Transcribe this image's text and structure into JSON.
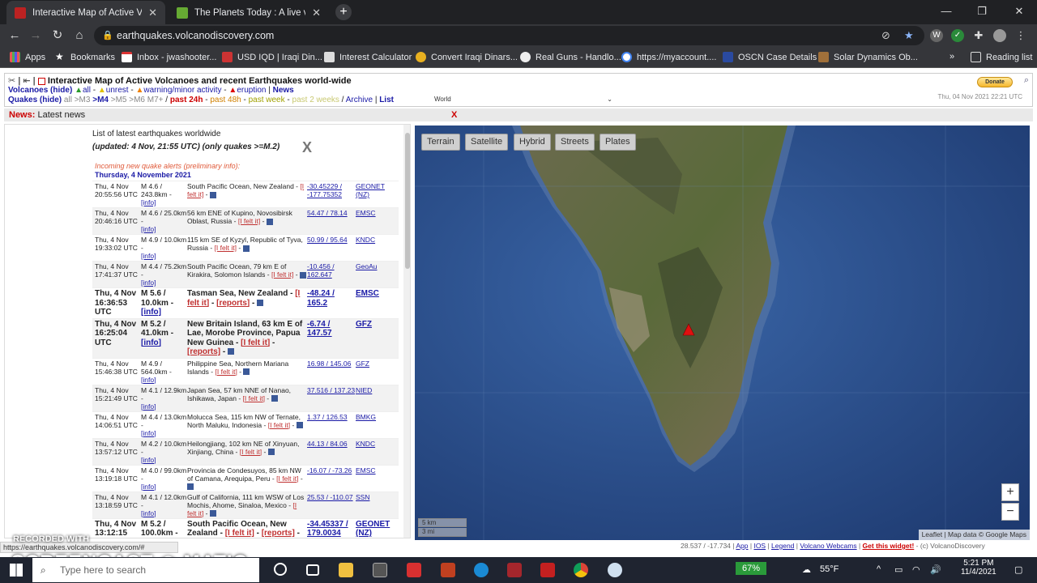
{
  "browser": {
    "tabs": [
      {
        "title": "Interactive Map of Active Volcan",
        "active": true
      },
      {
        "title": "The Planets Today : A live view of",
        "active": false
      }
    ],
    "url": "earthquakes.volcanodiscovery.com",
    "bookmarks": [
      "Apps",
      "Bookmarks",
      "Inbox - jwashooter...",
      "USD IQD | Iraqi Din...",
      "Interest Calculator",
      "Convert Iraqi Dinars...",
      "Real Guns - Handlo...",
      "https://myaccount....",
      "OSCN Case Details",
      "Solar Dynamics Ob..."
    ],
    "reading_list": "Reading list",
    "more": "»"
  },
  "header": {
    "title": "Interactive Map of Active Volcanoes and recent Earthquakes world-wide",
    "volcanoes_label": "Volcanoes (hide)",
    "v_all": "all",
    "v_unrest": "unrest",
    "v_warning": "warning/minor activity",
    "v_eruption": "eruption",
    "news_link": "News",
    "quakes_label": "Quakes (hide)",
    "q_all": "all",
    "q_m3": ">M3",
    "q_m4": ">M4",
    "q_m5": ">M5",
    "q_m6": ">M6",
    "q_m7": "M7+",
    "q_24h": "past 24h",
    "q_48h": "past 48h",
    "q_week": "past week",
    "q_2weeks": "past 2 weeks",
    "archive": "Archive",
    "list": "List",
    "region": "World",
    "donate": "Donate",
    "datetime": "Thu, 04 Nov 2021 22:21 UTC"
  },
  "newsbar": {
    "label": "News:",
    "text": "Latest news",
    "close": "X"
  },
  "list": {
    "title": "List of latest earthquakes worldwide",
    "updated": "(updated: 4 Nov, 21:55 UTC) (only quakes >=M.2)",
    "close": "X",
    "incoming": "Incoming new quake alerts (preliminary info):",
    "day": "Thursday, 4 November 2021",
    "rows": [
      {
        "time": "Thu, 4 Nov 20:55:56 UTC",
        "mag": "M 4.6 / 243.8km -",
        "info": "[info]",
        "loc": "South Pacific Ocean, New Zealand -",
        "felt": "[I felt it]",
        "reports": "",
        "coords": "-30.45229 / -177.75352",
        "agency": "GEONET (NZ)",
        "big": false
      },
      {
        "time": "Thu, 4 Nov 20:46:16 UTC",
        "mag": "M 4.6 / 25.0km -",
        "info": "[info]",
        "loc": "56 km ENE of Kupino, Novosibirsk Oblast, Russia -",
        "felt": "[I felt it]",
        "reports": "",
        "coords": "54.47 / 78.14",
        "agency": "EMSC",
        "big": false
      },
      {
        "time": "Thu, 4 Nov 19:33:02 UTC",
        "mag": "M 4.9 / 10.0km -",
        "info": "[info]",
        "loc": "115 km SE of Kyzyl, Republic of Tyva, Russia -",
        "felt": "[I felt it]",
        "reports": "",
        "coords": "50.99 / 95.64",
        "agency": "KNDC",
        "big": false
      },
      {
        "time": "Thu, 4 Nov 17:41:37 UTC",
        "mag": "M 4.4 / 75.2km -",
        "info": "[info]",
        "loc": "South Pacific Ocean, 79 km E of Kirakira, Solomon Islands -",
        "felt": "[I felt it]",
        "reports": "",
        "coords": "-10.456 / 162.647",
        "agency": "GeoAu",
        "big": false
      },
      {
        "time": "Thu, 4 Nov 16:36:53 UTC",
        "mag": "M 5.6 / 10.0km -",
        "info": "[info]",
        "loc": "Tasman Sea, New Zealand -",
        "felt": "[I felt it]",
        "reports": "[reports]",
        "coords": "-48.24 / 165.2",
        "agency": "EMSC",
        "big": true
      },
      {
        "time": "Thu, 4 Nov 16:25:04 UTC",
        "mag": "M 5.2 / 41.0km -",
        "info": "[info]",
        "loc": "New Britain Island, 63 km E of Lae, Morobe Province, Papua New Guinea -",
        "felt": "[I felt it]",
        "reports": "[reports]",
        "coords": "-6.74 / 147.57",
        "agency": "GFZ",
        "big": true
      },
      {
        "time": "Thu, 4 Nov 15:46:38 UTC",
        "mag": "M 4.9 / 564.0km -",
        "info": "[info]",
        "loc": "Philippine Sea, Northern Mariana Islands -",
        "felt": "[I felt it]",
        "reports": "",
        "coords": "16.98 / 145.06",
        "agency": "GFZ",
        "big": false
      },
      {
        "time": "Thu, 4 Nov 15:21:49 UTC",
        "mag": "M 4.1 / 12.9km -",
        "info": "[info]",
        "loc": "Japan Sea, 57 km NNE of Nanao, Ishikawa, Japan -",
        "felt": "[I felt it]",
        "reports": "",
        "coords": "37.516 / 137.23",
        "agency": "NIED",
        "big": false
      },
      {
        "time": "Thu, 4 Nov 14:06:51 UTC",
        "mag": "M 4.4 / 13.0km -",
        "info": "[info]",
        "loc": "Molucca Sea, 115 km NW of Ternate, North Maluku, Indonesia -",
        "felt": "[I felt it]",
        "reports": "",
        "coords": "1.37 / 126.53",
        "agency": "BMKG",
        "big": false
      },
      {
        "time": "Thu, 4 Nov 13:57:12 UTC",
        "mag": "M 4.2 / 10.0km -",
        "info": "[info]",
        "loc": "Heilongjiang, 102 km NE of Xinyuan, Xinjiang, China -",
        "felt": "[I felt it]",
        "reports": "",
        "coords": "44.13 / 84.06",
        "agency": "KNDC",
        "big": false
      },
      {
        "time": "Thu, 4 Nov 13:19:18 UTC",
        "mag": "M 4.0 / 99.0km -",
        "info": "[info]",
        "loc": "Provincia de Condesuyos, 85 km NW of Camana, Arequipa, Peru -",
        "felt": "[I felt it]",
        "reports": "",
        "coords": "-16.07 / -73.26",
        "agency": "EMSC",
        "big": false
      },
      {
        "time": "Thu, 4 Nov 13:18:59 UTC",
        "mag": "M 4.1 / 12.0km -",
        "info": "[info]",
        "loc": "Gulf of California, 111 km WSW of Los Mochis, Ahome, Sinaloa, Mexico -",
        "felt": "[I felt it]",
        "reports": "",
        "coords": "25.53 / -110.07",
        "agency": "SSN",
        "big": false
      },
      {
        "time": "Thu, 4 Nov 13:12:15",
        "mag": "M 5.2 / 100.0km -",
        "info": "",
        "loc": "South Pacific Ocean, New Zealand -",
        "felt": "[I felt it]",
        "reports": "[reports]",
        "coords": "-34.45337 / 179.0034",
        "agency": "GEONET (NZ)",
        "big": true
      }
    ]
  },
  "map": {
    "buttons": [
      "Terrain",
      "Satellite",
      "Hybrid",
      "Streets",
      "Plates"
    ],
    "zoom_in": "+",
    "zoom_out": "−",
    "scale_km": "5 km",
    "scale_mi": "3 mi",
    "attribution": "Leaflet | Map data © Google Maps"
  },
  "footer": {
    "coords": "28.537 / -17.734",
    "app": "App",
    "ios": "IOS",
    "legend": "Legend",
    "webcams": "Volcano Webcams",
    "widget": "Get this widget!",
    "copyright": "- (c) VolcanoDiscovery"
  },
  "statusbar": "https://earthquakes.volcanodiscovery.com/#",
  "watermark": {
    "line1": "RECORDED WITH",
    "line2": "SCREENCAST ◎ MATIC"
  },
  "taskbar": {
    "search": "Type here to search",
    "battery": "67%",
    "temp": "55°F",
    "time": "5:21 PM",
    "date": "11/4/2021"
  }
}
